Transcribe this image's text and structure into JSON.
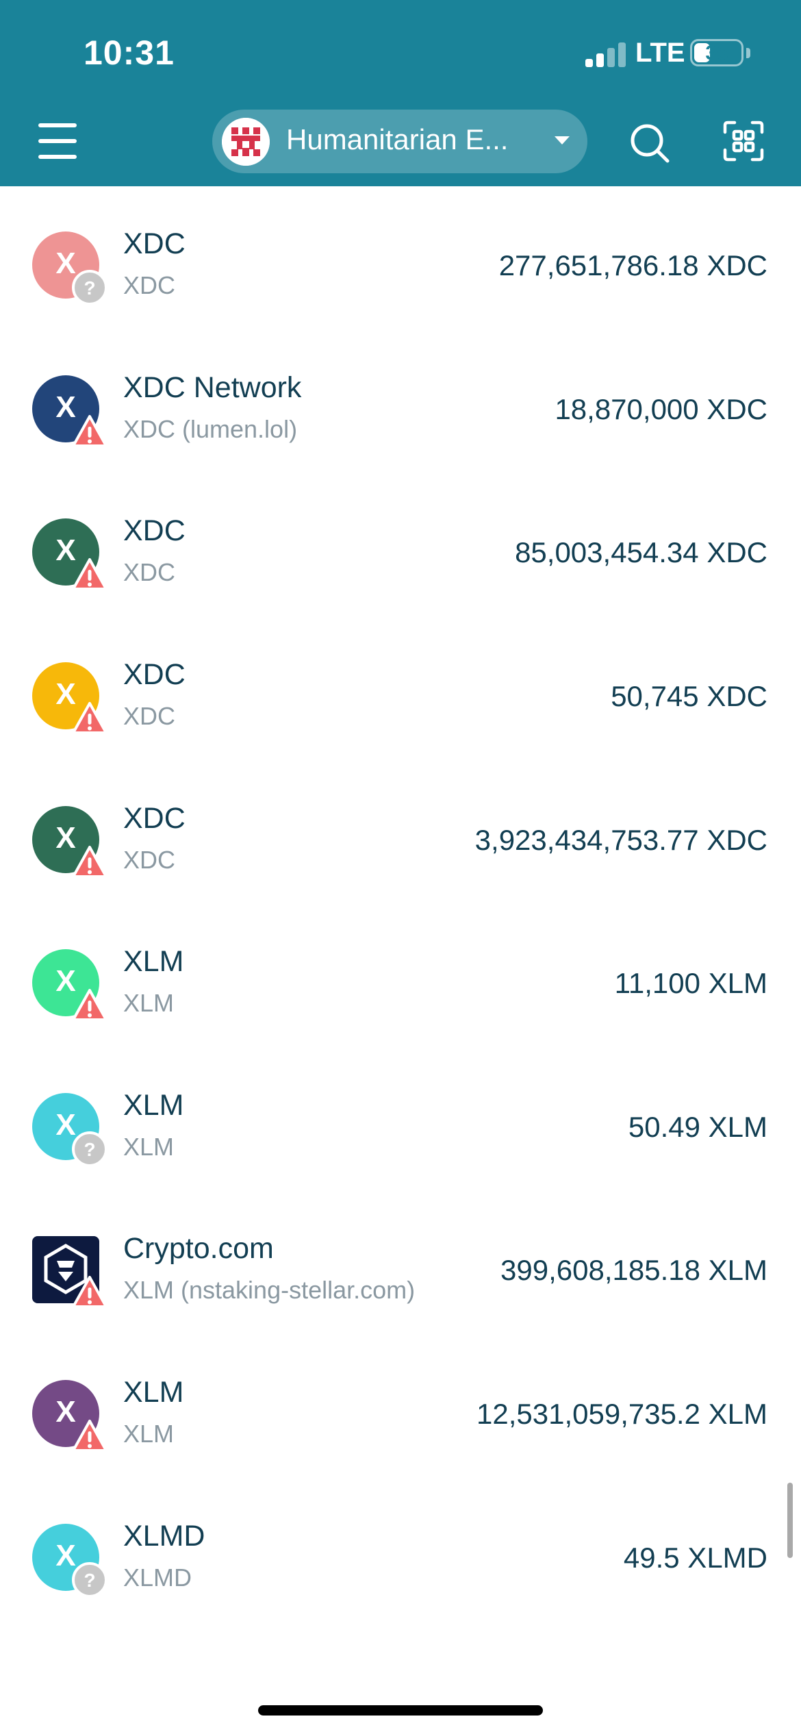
{
  "status_bar": {
    "time": "10:31",
    "network": "LTE",
    "battery": "35",
    "battery_level": 0.35
  },
  "header": {
    "wallet_name": "Humanitarian E...",
    "icons": [
      "menu-icon",
      "wallet-avatar",
      "chevron-down-icon",
      "search-icon",
      "scan-icon"
    ]
  },
  "colors": {
    "header_bg": "#1a8399",
    "warning": "#f26868",
    "unknown_badge": "#c7c7c7"
  },
  "tokens": [
    {
      "name": "XDC",
      "sub": "XDC",
      "balance": "277,651,786.18 XDC",
      "icon_letter": "X",
      "icon_color": "#ee9494",
      "badge": "question"
    },
    {
      "name": "XDC Network",
      "sub": "XDC (lumen.lol)",
      "balance": "18,870,000 XDC",
      "icon_letter": "X",
      "icon_color": "#22457a",
      "badge": "warning"
    },
    {
      "name": "XDC",
      "sub": "XDC",
      "balance": "85,003,454.34 XDC",
      "icon_letter": "X",
      "icon_color": "#2e6e55",
      "badge": "warning"
    },
    {
      "name": "XDC",
      "sub": "XDC",
      "balance": "50,745 XDC",
      "icon_letter": "X",
      "icon_color": "#f7b80a",
      "badge": "warning"
    },
    {
      "name": "XDC",
      "sub": "XDC",
      "balance": "3,923,434,753.77 XDC",
      "icon_letter": "X",
      "icon_color": "#2e6e55",
      "badge": "warning"
    },
    {
      "name": "XLM",
      "sub": "XLM",
      "balance": "11,100 XLM",
      "icon_letter": "X",
      "icon_color": "#3de595",
      "badge": "warning"
    },
    {
      "name": "XLM",
      "sub": "XLM",
      "balance": "50.49 XLM",
      "icon_letter": "X",
      "icon_color": "#45cfdc",
      "badge": "question"
    },
    {
      "name": "Crypto.com",
      "sub": "XLM (nstaking-stellar.com)",
      "balance": "399,608,185.18 XLM",
      "icon_letter": "",
      "icon_color": "#0d1a3f",
      "badge": "warning"
    },
    {
      "name": "XLM",
      "sub": "XLM",
      "balance": "12,531,059,735.2 XLM",
      "icon_letter": "X",
      "icon_color": "#744a86",
      "badge": "warning"
    },
    {
      "name": "XLMD",
      "sub": "XLMD",
      "balance": "49.5 XLMD",
      "icon_letter": "X",
      "icon_color": "#45cfdc",
      "badge": "question"
    }
  ]
}
